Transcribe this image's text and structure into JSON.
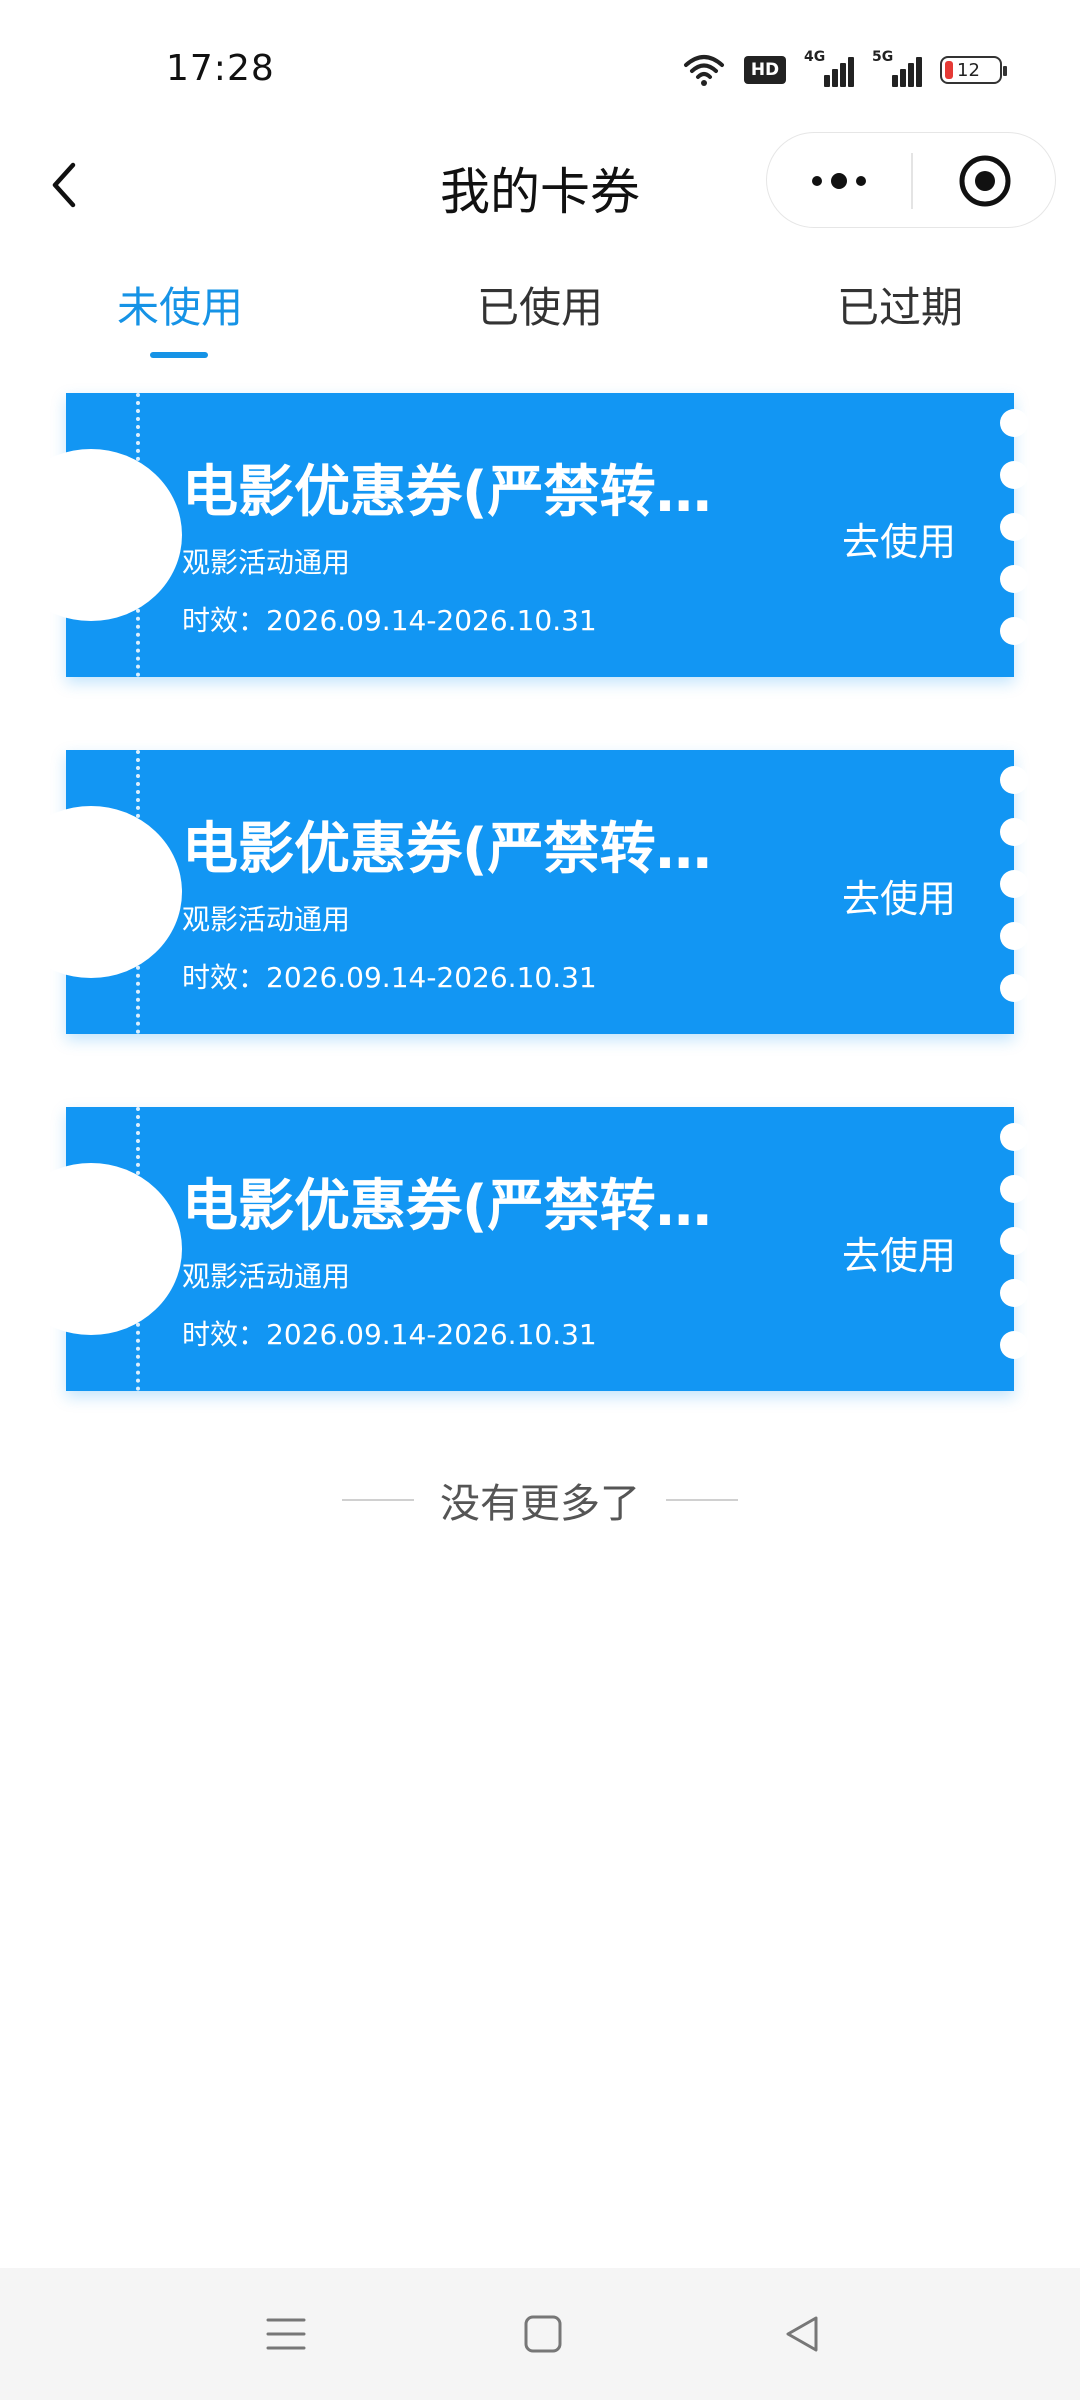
{
  "status_bar": {
    "time": "17:28",
    "hd_label": "HD",
    "signal_4g": "4G",
    "signal_5g": "5G",
    "battery_level": "12",
    "icons": [
      "wifi-icon",
      "hd-icon",
      "signal-4g-icon",
      "signal-5g-icon",
      "battery-icon"
    ]
  },
  "nav": {
    "title": "我的卡券",
    "back_icon": "chevron-left-icon",
    "more_icon": "more-dots-icon",
    "close_icon": "target-circle-icon"
  },
  "tabs": [
    {
      "label": "未使用",
      "active": true
    },
    {
      "label": "已使用",
      "active": false
    },
    {
      "label": "已过期",
      "active": false
    }
  ],
  "coupons": [
    {
      "title": "电影优惠券(严禁转卖...",
      "subtitle": "观影活动通用",
      "validity": "时效：2026.09.14-2026.10.31",
      "action": "去使用"
    },
    {
      "title": "电影优惠券(严禁转卖...",
      "subtitle": "观影活动通用",
      "validity": "时效：2026.09.14-2026.10.31",
      "action": "去使用"
    },
    {
      "title": "电影优惠券(严禁转卖...",
      "subtitle": "观影活动通用",
      "validity": "时效：2026.09.14-2026.10.31",
      "action": "去使用"
    }
  ],
  "footer_text": "没有更多了",
  "system_nav": {
    "icons": [
      "menu-icon",
      "home-square-icon",
      "back-triangle-icon"
    ]
  },
  "colors": {
    "accent": "#1693e6",
    "coupon_bg": "#1296f3",
    "background": "#ffffff",
    "nav_bg": "#f5f5f5"
  }
}
